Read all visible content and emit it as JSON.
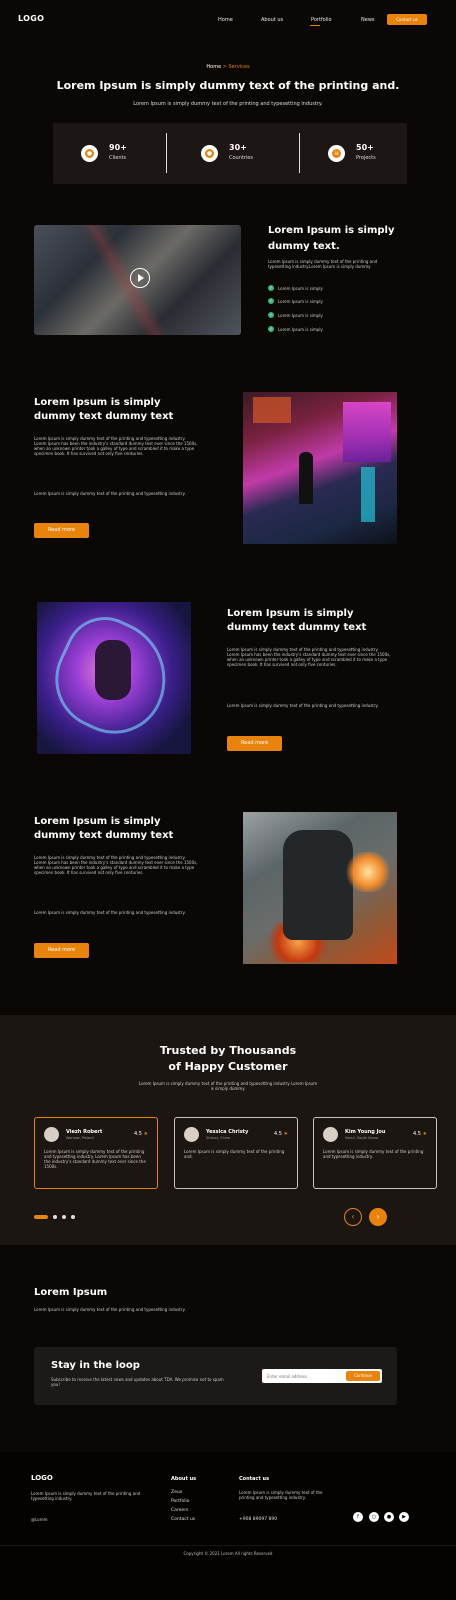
{
  "nav": {
    "logo": "LOGO",
    "links": [
      "Home",
      "About us",
      "Portfolio",
      "News"
    ],
    "contact": "Contact us"
  },
  "hero": {
    "breadcrumb_home": "Home",
    "breadcrumb_current": "> Services",
    "title": "Lorem Ipsum is simply dummy text of the printing and.",
    "subtitle": "Lorem Ipsum is simply dummy text of the printing and typesetting industry."
  },
  "stats": [
    {
      "value": "90+",
      "label": "Clients",
      "icon": "user-icon"
    },
    {
      "value": "30+",
      "label": "Countries",
      "icon": "location-pin-icon"
    },
    {
      "value": "50+",
      "label": "Projects",
      "icon": "list-icon"
    }
  ],
  "video_section": {
    "title": "Lorem Ipsum is simply dummy text.",
    "text": "Lorem Ipsum is simply dummy text of the printing and typesetting industry.Lorem Ipsum is simply dummy",
    "checklist": [
      "Lorem Ipsum is simply",
      "Lorem Ipsum is simply",
      "Lorem Ipsum is simply",
      "Lorem Ipsum is simply"
    ]
  },
  "features": [
    {
      "title": "Lorem Ipsum is simply dummy text dummy text",
      "p1": "Lorem Ipsum is simply dummy text of the printing and typesetting industry. Lorem Ipsum has been the industry's standard dummy text ever since the 1500s, when an unknown printer took a galley of type and scrambled it to make a type specimen book. It has survived not only five centuries.",
      "p2": "Lorem Ipsum is simply dummy text of the printing and typesetting industry.",
      "button": "Read more"
    },
    {
      "title": "Lorem Ipsum is simply dummy text dummy text",
      "p1": "Lorem Ipsum is simply dummy text of the printing and typesetting industry. Lorem Ipsum has been the industry's standard dummy text ever since the 1500s, when an unknown printer took a galley of type and scrambled it to make a type specimen book. It has survived not only five centuries.",
      "p2": "Lorem Ipsum is simply dummy text of the printing and typesetting industry.",
      "button": "Read more"
    },
    {
      "title": "Lorem Ipsum is simply dummy text dummy text",
      "p1": "Lorem Ipsum is simply dummy text of the printing and typesetting industry. Lorem Ipsum has been the industry's standard dummy text ever since the 1500s, when an unknown printer took a galley of type and scrambled it to make a type specimen book. It has survived not only five centuries.",
      "p2": "Lorem Ipsum is simply dummy text of the printing and typesetting industry.",
      "button": "Read more"
    }
  ],
  "testimonials": {
    "title": "Trusted by Thousands of Happy Customer",
    "subtitle": "Lorem Ipsum is simply dummy text of the printing and typesetting industry Lorem Ipsum is simply dummy.",
    "cards": [
      {
        "name": "Viezh Robert",
        "role": "Warsaw, Poland",
        "rating": "4.5",
        "text": "Lorem Ipsum is simply dummy text of the printing and typesetting industry. Lorem Ipsum has been the industry's standard dummy text ever since the 1500s."
      },
      {
        "name": "Yessica Christy",
        "role": "Shanxi, China",
        "rating": "4.5",
        "text": "Lorem Ipsum is simply dummy text of the printing and."
      },
      {
        "name": "Kim Young Jou",
        "role": "Seoul, South Korea",
        "rating": "4.5",
        "text": "Lorem Ipsum is simply dummy text of the printing and typesetting industry."
      }
    ]
  },
  "newsletter": {
    "heading": "Lorem Ipsum",
    "text": "Lorem Ipsum is simply dummy text of the printing and typesetting industry.",
    "box_title": "Stay in the loop",
    "box_text": "Subscribe to receive the latest news and updates about TDA. We promise not to spam you!",
    "placeholder": "Enter email address",
    "button": "Continue"
  },
  "footer": {
    "logo": "LOGO",
    "desc": "Lorem Ipsum is simply dummy text of the printing and typesetting industry.",
    "handle": "@Lorem",
    "about_title": "About us",
    "about_links": [
      "Zeux",
      "Portfolio",
      "Careers",
      "Contact us"
    ],
    "contact_title": "Contact us",
    "contact_text": "Lorem Ipsum is simply dummy text of the printing and typesetting industry.",
    "phone": "+908 89097 890",
    "copyright": "Copyright © 2021 Lorem All rights Reserved"
  },
  "colors": {
    "accent": "#e8830e",
    "background": "#0a0705",
    "check": "#3fb37a"
  }
}
